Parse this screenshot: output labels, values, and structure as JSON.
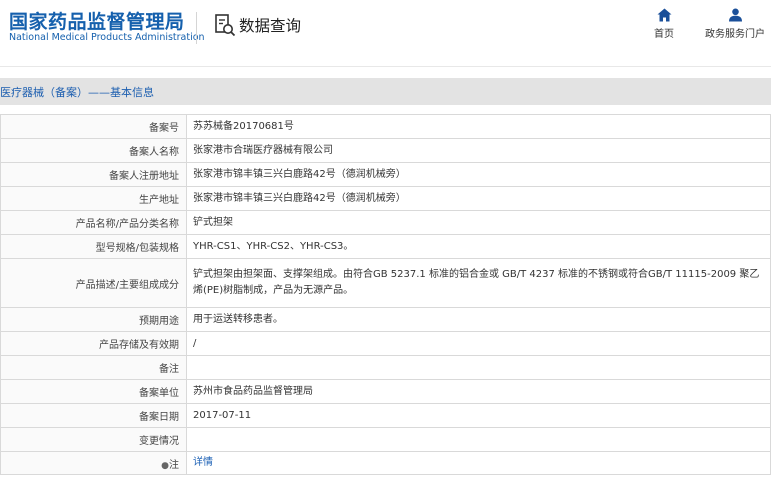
{
  "header": {
    "logo_cn": "国家药品监督管理局",
    "logo_en": "National Medical Products Administration",
    "search_title": "数据查询",
    "nav": {
      "home": "首页",
      "portal": "政务服务门户"
    }
  },
  "section": {
    "title": "医疗器械（备案）——基本信息"
  },
  "rows": [
    {
      "label": "备案号",
      "value": "苏苏械备20170681号"
    },
    {
      "label": "备案人名称",
      "value": "张家港市合瑞医疗器械有限公司"
    },
    {
      "label": "备案人注册地址",
      "value": "张家港市锦丰镇三兴白鹿路42号（德润机械旁）"
    },
    {
      "label": "生产地址",
      "value": "张家港市锦丰镇三兴白鹿路42号（德润机械旁）"
    },
    {
      "label": "产品名称/产品分类名称",
      "value": "铲式担架"
    },
    {
      "label": "型号规格/包装规格",
      "value": "YHR-CS1、YHR-CS2、YHR-CS3。"
    },
    {
      "label": "产品描述/主要组成成分",
      "value": "铲式担架由担架面、支撑架组成。由符合GB 5237.1 标准的铝合金或 GB/T 4237 标准的不锈钢或符合GB/T 11115-2009 聚乙烯(PE)树脂制成，产品为无源产品。"
    },
    {
      "label": "预期用途",
      "value": "用于运送转移患者。"
    },
    {
      "label": "产品存储及有效期",
      "value": "/"
    },
    {
      "label": "备注",
      "value": ""
    },
    {
      "label": "备案单位",
      "value": "苏州市食品药品监督管理局"
    },
    {
      "label": "备案日期",
      "value": "2017-07-11"
    },
    {
      "label": "变更情况",
      "value": ""
    },
    {
      "label": "注",
      "value": "详情"
    }
  ],
  "colors": {
    "brand_blue": "#1560ad",
    "link_blue": "#1a5fb4",
    "section_bg": "#e3e3e3",
    "border": "#d9d9d9"
  },
  "icons": {
    "search": "document-search-icon",
    "home": "home-icon",
    "portal": "user-icon",
    "note": "pin-icon"
  }
}
